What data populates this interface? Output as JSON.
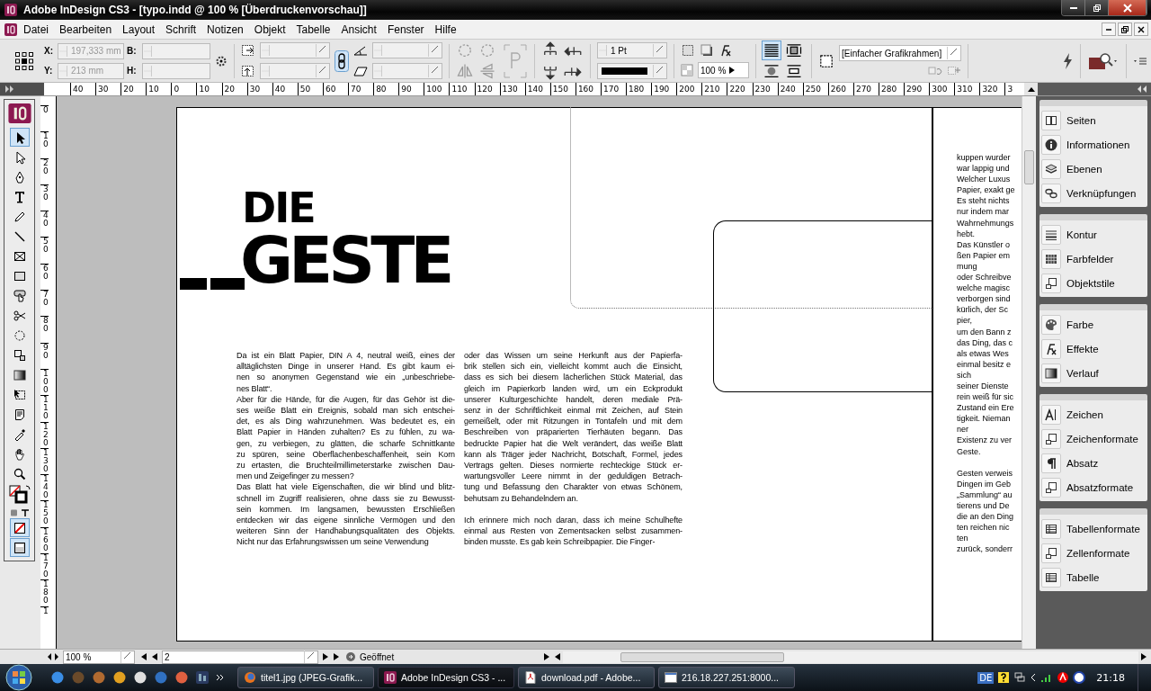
{
  "window": {
    "title": "Adobe InDesign CS3 - [typo.indd @ 100 % [Überdruckenvorschau]]"
  },
  "menu": [
    "Datei",
    "Bearbeiten",
    "Layout",
    "Schrift",
    "Notizen",
    "Objekt",
    "Tabelle",
    "Ansicht",
    "Fenster",
    "Hilfe"
  ],
  "control_panel": {
    "x_label": "X:",
    "x_value": "197,333 mm",
    "y_label": "Y:",
    "y_value": "213 mm",
    "w_label": "B:",
    "h_label": "H:",
    "stroke_weight": "1 Pt",
    "opacity": "100 %",
    "object_style": "[Einfacher Grafikrahmen]"
  },
  "ruler": {
    "horizontal": [
      "40",
      "30",
      "20",
      "10",
      "0",
      "10",
      "20",
      "30",
      "40",
      "50",
      "60",
      "70",
      "80",
      "90",
      "100",
      "110",
      "120",
      "130",
      "140",
      "150",
      "160",
      "170",
      "180",
      "190",
      "200",
      "210",
      "220",
      "230",
      "240",
      "250",
      "260",
      "270",
      "280",
      "290",
      "300",
      "310",
      "320",
      "3"
    ],
    "vertical": [
      "0",
      "10",
      "20",
      "30",
      "40",
      "50",
      "60",
      "70",
      "80",
      "90",
      "100",
      "110",
      "120",
      "130",
      "140",
      "150",
      "160",
      "170",
      "180",
      "1"
    ]
  },
  "tools": [
    {
      "kind": "selection",
      "selected": true
    },
    {
      "kind": "direct",
      "selected": false
    },
    {
      "kind": "pen",
      "selected": false
    },
    {
      "kind": "type",
      "selected": false
    },
    {
      "kind": "pencil",
      "selected": false
    },
    {
      "kind": "line",
      "selected": false
    },
    {
      "kind": "frame",
      "selected": false
    },
    {
      "kind": "rect",
      "selected": false
    },
    {
      "kind": "button",
      "selected": false
    },
    {
      "kind": "scissors",
      "selected": false
    },
    {
      "kind": "rotate",
      "selected": false
    },
    {
      "kind": "scale",
      "selected": false
    },
    {
      "kind": "gradient",
      "selected": false
    },
    {
      "kind": "transform",
      "selected": false
    },
    {
      "kind": "note",
      "selected": false
    },
    {
      "kind": "eyedropper",
      "selected": false
    },
    {
      "kind": "hand",
      "selected": false
    },
    {
      "kind": "zoom",
      "selected": false
    }
  ],
  "document": {
    "heading": {
      "line_1": "DIE",
      "line_2": "GESTE"
    },
    "columns": [
      [
        [
          "Da ist ein Blatt Papier, DIN A 4, neutral weiß, eines der",
          "alltäglichsten Dinge in unserer Hand. Es gibt kaum ei-",
          "nen so anonymen Gegenstand wie ein „unbeschriebe-",
          "nes Blatt“."
        ],
        [
          "Aber für die Hände, für die Augen, für das Gehör ist die-",
          "ses weiße Blatt ein Ereignis, sobald man sich entschei-",
          "det, es als Ding wahrzunehmen. Was bedeutet es, ein",
          "Blatt Papier in Händen zuhalten? Es zu fühlen, zu wa-",
          "gen, zu verbiegen, zu glätten, die scharfe Schnittkante",
          "zu spüren, seine Oberflachenbeschaffenheit, sein Korn",
          "zu ertasten, die Bruchteilmillimeterstarke zwischen Dau-",
          "men und Zeigefinger zu messen?"
        ],
        [
          "Das Blatt hat viele Eigenschaften, die wir blind und blitz-",
          "schnell im Zugriff realisieren, ohne dass sie zu Bewusst-",
          "sein kommen. Im langsamen, bewussten Erschließen",
          "entdecken wir das eigene sinnliche Vermögen und den",
          "weiteren Sinn der Handhabungsqualitäten des Objekts.",
          "Nicht nur das Erfahrungswissen um seine Verwendung"
        ]
      ],
      [
        [
          "oder das Wissen um seine Herkunft aus der Papierfa-",
          "brik stellen sich ein, vielleicht kommt auch die Einsicht,",
          "dass es sich bei diesem lächerlichen Stück Material, das",
          "gleich im Papierkorb landen wird, um ein Eckprodukt",
          "unserer Kulturgeschichte handelt, deren mediale Prä-",
          "senz in der Schriftlichkeit einmal mit Zeichen, auf Stein",
          "gemeißelt, oder mit Ritzungen in Tontafeln und mit dem",
          "Beschreiben von präparierten Tierhäuten begann. Das",
          "bedruckte Papier hat die Welt verändert, das weiße Blatt",
          "kann als Träger jeder Nachricht, Botschaft, Formel, jedes",
          "Vertrags gelten. Dieses normierte rechteckige Stück er-",
          "wartungsvoller Leere nimmt in der geduldigen Betrach-",
          "tung und Befassung den Charakter von etwas Schönem,",
          "behutsam zu Behandelndem an."
        ],
        [
          "Ich erinnere mich noch daran, dass ich meine Schulhefte",
          "einmal aus Resten von Zementsacken selbst zusammen-",
          "binden musste. Es gab kein Schreibpapier. Die Finger-"
        ]
      ]
    ],
    "next_page_column": [
      [
        "kuppen wurder",
        "war lappig und",
        "Welcher Luxus",
        "Papier, exakt ge",
        "Es steht nichts",
        "nur indem mar",
        "Wahrnehmungs",
        "hebt.",
        "Das Künstler o",
        "ßen Papier em",
        "mung",
        "oder Schreibve",
        "welche magisc",
        "verborgen sind",
        "kürlich, der Sc",
        "pier,",
        "um den Bann z",
        "das Ding, das c",
        "als etwas Wes",
        "einmal besitz e",
        "sich",
        "seiner Dienste",
        "rein weiß für sic",
        "Zustand ein Ere",
        "tigkeit. Nieman",
        "ner",
        "Existenz zu ver",
        "Geste."
      ],
      [
        "Gesten verweis",
        "Dingen im Geb",
        "„Sammlung“ au",
        "tierens und De",
        "die an den Ding",
        "ten reichen nic",
        "ten",
        "zurück, sonderr"
      ]
    ]
  },
  "panels": [
    [
      {
        "kind": "pages",
        "label": "Seiten"
      },
      {
        "kind": "info",
        "label": "Informationen"
      },
      {
        "kind": "layers",
        "label": "Ebenen"
      },
      {
        "kind": "links",
        "label": "Verknüpfungen"
      }
    ],
    [
      {
        "kind": "stroke",
        "label": "Kontur"
      },
      {
        "kind": "swatches",
        "label": "Farbfelder"
      },
      {
        "kind": "styles",
        "label": "Objektstile"
      }
    ],
    [
      {
        "kind": "color",
        "label": "Farbe"
      },
      {
        "kind": "effects",
        "label": "Effekte"
      },
      {
        "kind": "gradient",
        "label": "Verlauf"
      }
    ],
    [
      {
        "kind": "character",
        "label": "Zeichen"
      },
      {
        "kind": "styles",
        "label": "Zeichenformate"
      },
      {
        "kind": "paragraph",
        "label": "Absatz"
      },
      {
        "kind": "styles",
        "label": "Absatzformate"
      }
    ],
    [
      {
        "kind": "table",
        "label": "Tabellenformate"
      },
      {
        "kind": "styles",
        "label": "Zellenformate"
      },
      {
        "kind": "table",
        "label": "Tabelle"
      }
    ]
  ],
  "status_bar": {
    "zoom": "100 %",
    "page": "2",
    "status": "Geöffnet"
  },
  "taskbar": {
    "tasks": [
      {
        "kind": "browser",
        "label": "titel1.jpg (JPEG-Grafik...",
        "selected": false
      },
      {
        "kind": "indesign",
        "label": "Adobe InDesign CS3 - ...",
        "selected": true
      },
      {
        "kind": "pdf",
        "label": "download.pdf - Adobe...",
        "selected": false
      },
      {
        "kind": "window",
        "label": "216.18.227.251:8000...",
        "selected": false
      }
    ],
    "language": "DE",
    "time": "21:18"
  }
}
